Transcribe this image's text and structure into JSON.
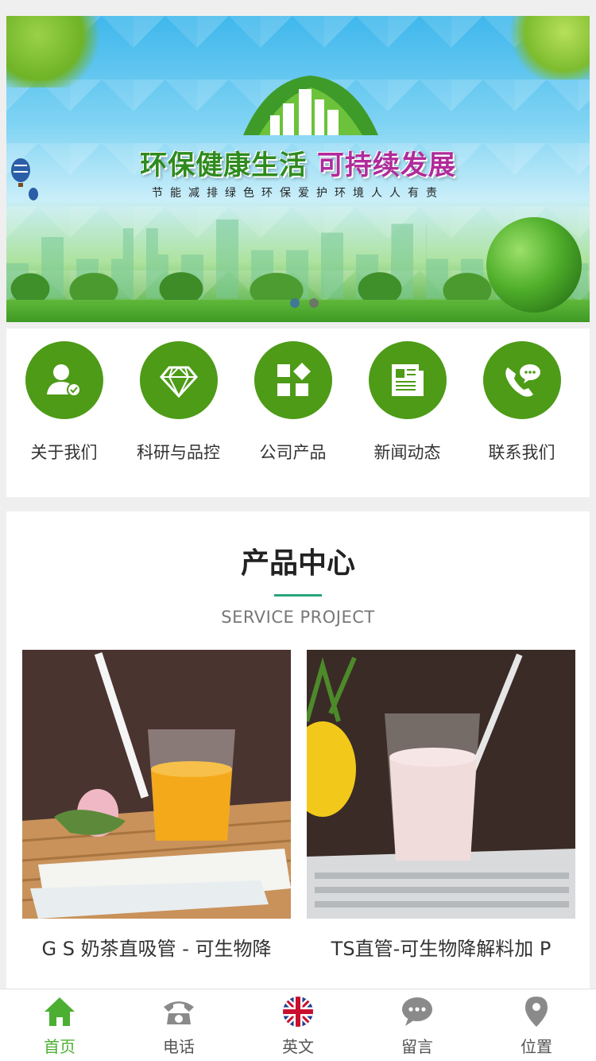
{
  "banner": {
    "title_part1": "环保健康生活",
    "title_part2": "可持续发展",
    "subtitle": "节能减排绿色环保爱护环境人人有责",
    "slides": 2,
    "active_slide": 2
  },
  "nav": {
    "items": [
      {
        "label": "关于我们",
        "icon": "user-check-icon"
      },
      {
        "label": "科研与品控",
        "icon": "diamond-icon"
      },
      {
        "label": "公司产品",
        "icon": "apps-grid-icon"
      },
      {
        "label": "新闻动态",
        "icon": "newspaper-icon"
      },
      {
        "label": "联系我们",
        "icon": "phone-chat-icon"
      }
    ]
  },
  "products": {
    "title": "产品中心",
    "subtitle": "SERVICE PROJECT",
    "items": [
      {
        "name": "G S 奶茶直吸管 - 可生物降"
      },
      {
        "name": "TS直管-可生物降解料加 P"
      }
    ]
  },
  "tabbar": {
    "items": [
      {
        "label": "首页",
        "icon": "home-icon",
        "active": true
      },
      {
        "label": "电话",
        "icon": "telephone-icon",
        "active": false
      },
      {
        "label": "英文",
        "icon": "uk-flag-icon",
        "active": false
      },
      {
        "label": "留言",
        "icon": "message-bubble-icon",
        "active": false
      },
      {
        "label": "位置",
        "icon": "location-pin-icon",
        "active": false
      }
    ]
  },
  "colors": {
    "brand_green": "#4d9b17",
    "accent_teal": "#2aa57d",
    "active_tab": "#4caf32"
  }
}
